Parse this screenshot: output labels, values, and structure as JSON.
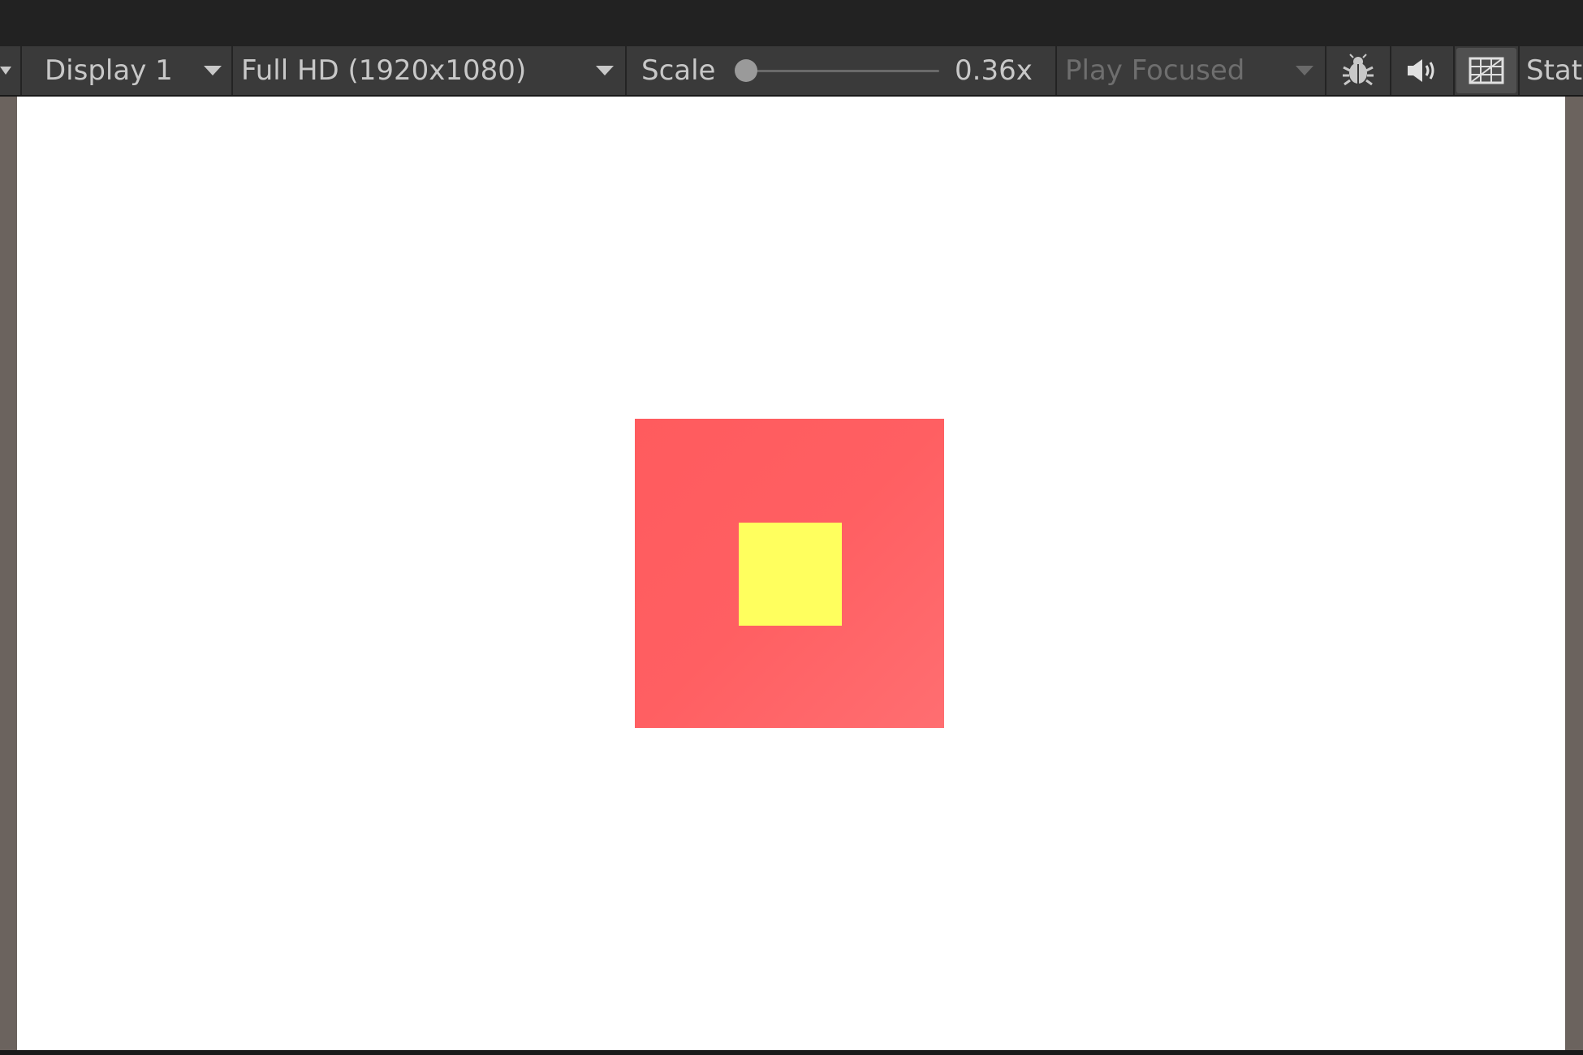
{
  "toolbar": {
    "display_label": "Display 1",
    "resolution_label": "Full HD (1920x1080)",
    "scale_label": "Scale",
    "scale_value_label": "0.36x",
    "play_mode_label": "Play Focused",
    "stats_label": "Stat",
    "scale_level": 0.0
  },
  "icons": {
    "display_menu": "chevron-down-icon",
    "debug": "bug-icon",
    "audio": "speaker-icon",
    "gizmos": "gizmo-grid-icon"
  },
  "viewport": {
    "background_color": "#ffffff",
    "outer_square_color": "#ff5b5e",
    "inner_square_color": "#ffff5e"
  }
}
